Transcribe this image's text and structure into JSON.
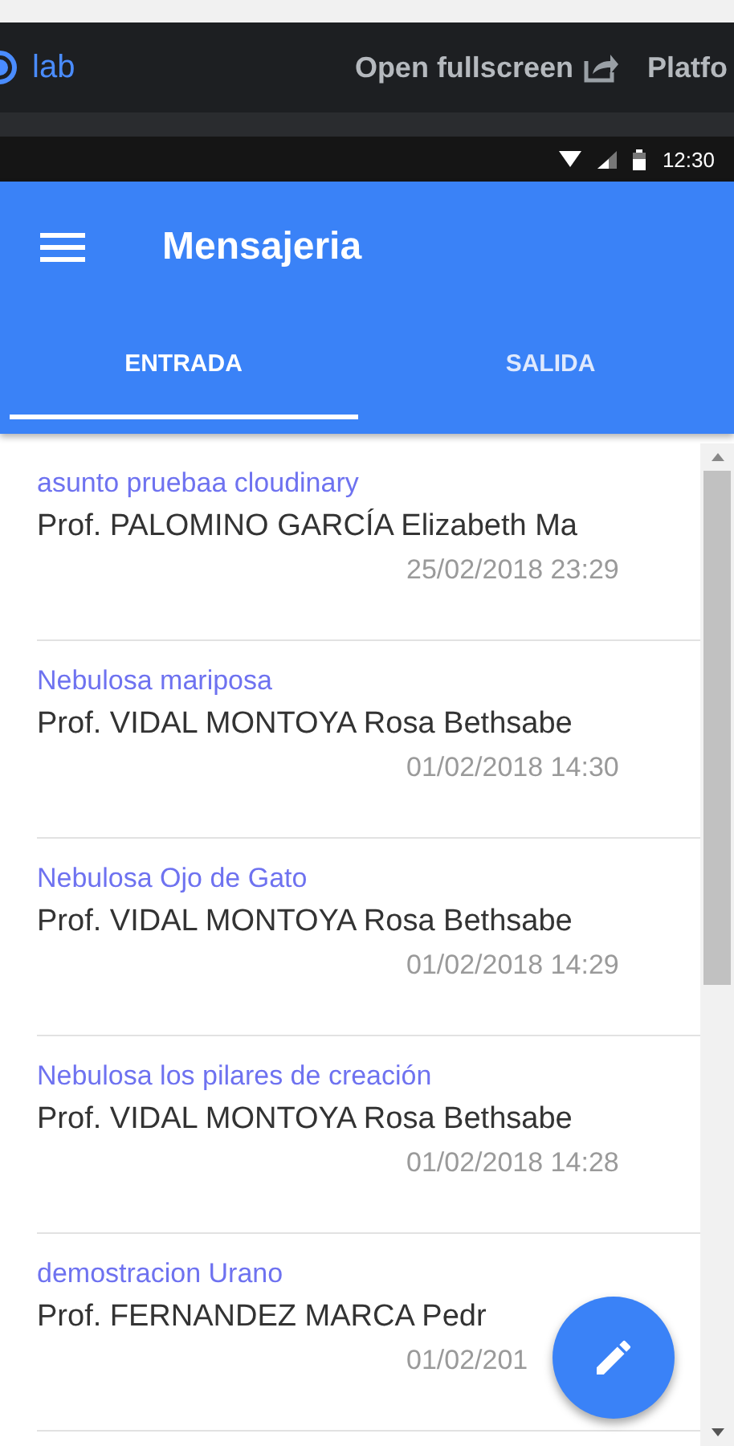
{
  "lab_bar": {
    "logo": "lab",
    "open_fullscreen": "Open fullscreen",
    "platform": "Platfo"
  },
  "status_bar": {
    "time": "12:30"
  },
  "toolbar": {
    "title": "Mensajeria"
  },
  "tabs": [
    {
      "label": "ENTRADA",
      "selected": true
    },
    {
      "label": "SALIDA",
      "selected": false
    }
  ],
  "messages": [
    {
      "subject": "asunto pruebaa cloudinary",
      "sender": "Prof. PALOMINO GARCÍA Elizabeth Ma",
      "date": "25/02/2018 23:29"
    },
    {
      "subject": "Nebulosa mariposa",
      "sender": "Prof. VIDAL MONTOYA Rosa Bethsabe",
      "date": "01/02/2018 14:30"
    },
    {
      "subject": "Nebulosa Ojo de Gato",
      "sender": "Prof. VIDAL MONTOYA Rosa Bethsabe",
      "date": "01/02/2018 14:29"
    },
    {
      "subject": "Nebulosa los pilares de creación",
      "sender": "Prof. VIDAL MONTOYA Rosa Bethsabe",
      "date": "01/02/2018 14:28"
    },
    {
      "subject": "demostracion Urano",
      "sender": "Prof. FERNANDEZ MARCA Pedr",
      "date": "01/02/201"
    }
  ]
}
